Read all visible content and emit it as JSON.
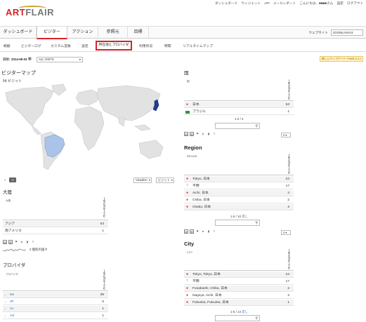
{
  "topbar": {
    "links": [
      "ダッシュボード",
      "ウィジェット",
      "API",
      "メールレポート",
      "こんにちは、■■■■さん",
      "設定",
      "ログアウト"
    ]
  },
  "brand": {
    "art": "ART",
    "flair": "FLAIR"
  },
  "nav": {
    "tabs": [
      "ダッシュボード",
      "ビジター",
      "アクション",
      "参照元",
      "目標"
    ],
    "active_tab": "ビジター",
    "site_label": "ウェブサイト",
    "site_value": "ZOOMLANAV3"
  },
  "subnav": {
    "tabs": [
      "概観",
      "ビジターログ",
      "カスタム変数",
      "設定",
      "所在地とプロバイダ",
      "利用状況",
      "時間",
      "リアルタイムマップ"
    ],
    "active": "所在地とプロバイダ"
  },
  "datebar": {
    "date_label": "日付:",
    "date_value": "2014-08-03",
    "segment_value": "ALL VISITS",
    "notice": "新しいアップデート: PIWIK 2.4.1"
  },
  "visitor_map": {
    "title": "ビジターマップ",
    "visits": "54 ビジット",
    "zoom_select": "Visualize",
    "metric_select": "ビジット"
  },
  "continent": {
    "title": "大陸",
    "col_label": "大陸",
    "col_metric": "ユニークビジター",
    "rows": [
      {
        "label": "アジア",
        "value": "53"
      },
      {
        "label": "南アメリカ",
        "value": "1"
      }
    ],
    "sparkline_label": "2 個別の国々"
  },
  "provider": {
    "title": "プロバイダ",
    "col_label": "プロバイダ",
    "col_metric": "ユニークビジター",
    "rows": [
      {
        "label": "Ne",
        "value": "38"
      },
      {
        "label": "JP",
        "value": "6"
      },
      {
        "label": "Ac",
        "value": "1"
      },
      {
        "label": "Ad",
        "value": "1"
      }
    ]
  },
  "country": {
    "title": "国",
    "col_label": "国",
    "col_metric": "ユニークビジター",
    "rows": [
      {
        "label": "日本",
        "value": "53"
      },
      {
        "label": "ブラジル",
        "value": "1"
      }
    ],
    "pager": "1-2 / 2",
    "limit": "5"
  },
  "region": {
    "title": "Region",
    "col_label": "REGION",
    "col_metric": "ユニークビジター",
    "rows": [
      {
        "label": "Tokyo, 日本",
        "value": "24"
      },
      {
        "label": "不明",
        "value": "17"
      },
      {
        "label": "Aichi, 日本",
        "value": "4"
      },
      {
        "label": "Chiba, 日本",
        "value": "2"
      },
      {
        "label": "Osaka, 日本",
        "value": "2"
      }
    ],
    "pager": "1-5 / 10",
    "next": "次し",
    "limit": "5"
  },
  "city": {
    "title": "City",
    "col_label": "CITY",
    "col_metric": "ユニークビジター",
    "rows": [
      {
        "label": "Tokyo, Tokyo, 日本",
        "value": "24"
      },
      {
        "label": "不明",
        "value": "17"
      },
      {
        "label": "Funabashi, Chiba, 日本",
        "value": "2"
      },
      {
        "label": "Nagoya, Aichi, 日本",
        "value": "2"
      },
      {
        "label": "Fukuoka, Fukuoka, 日本",
        "value": "1"
      }
    ],
    "pager": "1-5 / 13",
    "next": "次し"
  },
  "colors": {
    "accent": "#d4232a",
    "japan": "#1f3f8f",
    "brazil": "#a9c4e8",
    "land": "#e4e4e4"
  }
}
